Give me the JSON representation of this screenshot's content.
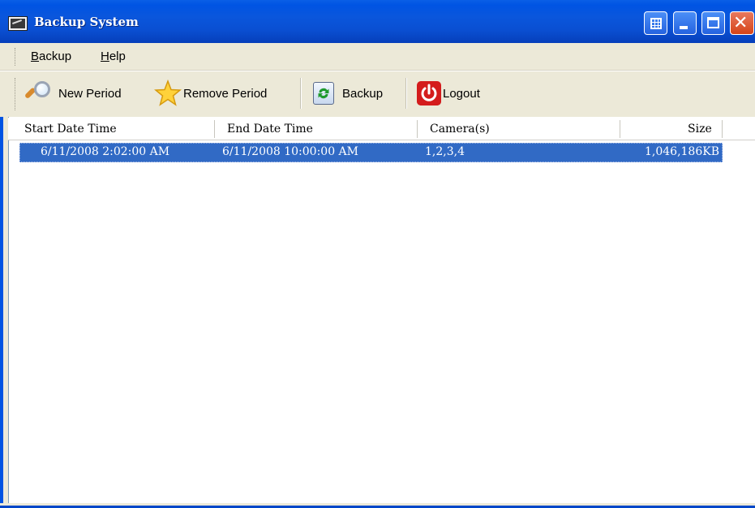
{
  "window": {
    "title": "Backup System",
    "controls": [
      "grid-icon",
      "minimize-icon",
      "maximize-icon",
      "close-icon"
    ],
    "close_glyph": "✕"
  },
  "menu": {
    "items": [
      {
        "label_u": "B",
        "label_rest": "ackup"
      },
      {
        "label_u": "H",
        "label_rest": "elp"
      }
    ]
  },
  "toolbar": {
    "new_period": "New Period",
    "remove_period": "Remove Period",
    "backup": "Backup",
    "logout": "Logout"
  },
  "table": {
    "columns": [
      "Start Date Time",
      "End Date Time",
      "Camera(s)",
      "Size"
    ],
    "rows": [
      {
        "start": "6/11/2008 2:02:00 AM",
        "end": "6/11/2008 10:00:00 AM",
        "cameras": "1,2,3,4",
        "size": "1,046,186KB",
        "selected": true
      }
    ]
  },
  "colors": {
    "titlebar": "#0054e3",
    "selection": "#316ac5",
    "chrome": "#ece9d8"
  }
}
